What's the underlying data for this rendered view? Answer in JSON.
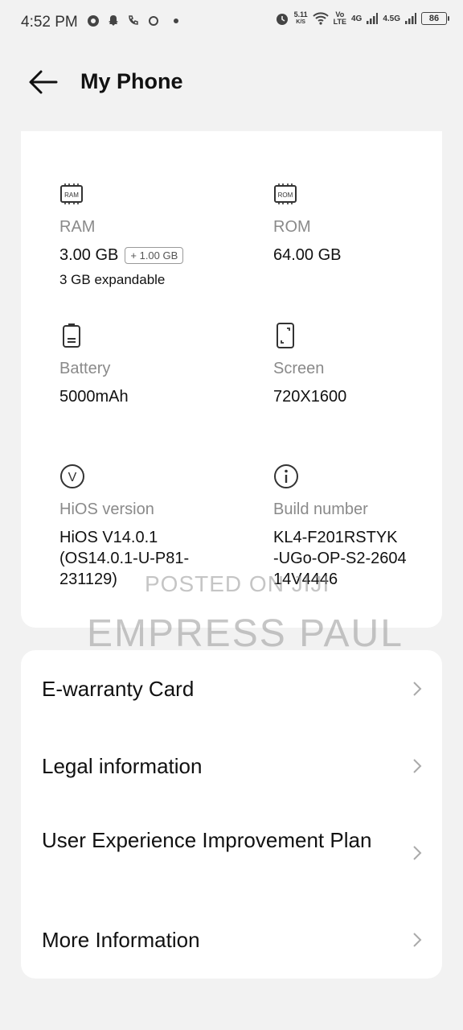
{
  "status_bar": {
    "time": "4:52 PM",
    "speed": "5.11",
    "speed_unit": "K/S",
    "volte_top": "Vo",
    "volte_bottom": "LTE",
    "sig1": "4G",
    "sig2": "4.5G",
    "battery": "86"
  },
  "header": {
    "title": "My Phone"
  },
  "specs": {
    "ram": {
      "icon_text": "RAM",
      "label": "RAM",
      "value": "3.00 GB",
      "extra": "+ 1.00 GB",
      "sub": "3 GB expandable"
    },
    "rom": {
      "icon_text": "ROM",
      "label": "ROM",
      "value": "64.00 GB"
    },
    "battery": {
      "label": "Battery",
      "value": "5000mAh"
    },
    "screen": {
      "label": "Screen",
      "value": "720X1600"
    },
    "hios": {
      "icon_text": "V",
      "label": "HiOS version",
      "value_line1": "HiOS V14.0.1",
      "value_line2": "(OS14.0.1-U-P81-",
      "value_line3": "231129)"
    },
    "build": {
      "label": "Build number",
      "value_line1": "KL4-F201RSTYK",
      "value_line2": "-UGo-OP-S2-2604",
      "value_line3": "14V4446"
    }
  },
  "watermark": {
    "small": "POSTED ON JIJI",
    "big": "EMPRESS PAUL"
  },
  "menu": [
    {
      "label": "E-warranty Card"
    },
    {
      "label": "Legal information"
    },
    {
      "label": "User Experience Improvement Plan"
    },
    {
      "label": "More Information"
    }
  ]
}
